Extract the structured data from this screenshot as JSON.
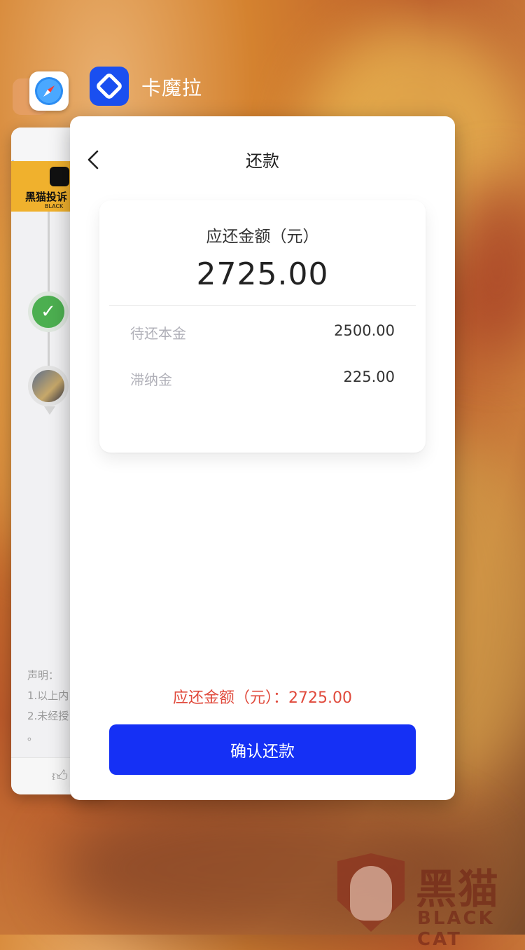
{
  "switcher": {
    "app_name": "卡魔拉",
    "app_icon": "kamola-logo-icon",
    "bg_app_icon": "safari-icon"
  },
  "background_app": {
    "banner_text": "黑猫投诉",
    "banner_sub": "BLACK",
    "statement_lines": [
      "声明：",
      "1.以上内",
      "2.未经授",
      "。"
    ]
  },
  "nav": {
    "title": "还款"
  },
  "repayment": {
    "due_label": "应还金额（元）",
    "due_amount": "2725.00",
    "rows": [
      {
        "label": "待还本金",
        "value": "2500.00"
      },
      {
        "label": "滞纳金",
        "value": "225.00"
      }
    ],
    "summary": "应还金额（元）：2725.00",
    "confirm_label": "确认还款"
  },
  "watermark": {
    "cn": "黑猫",
    "en": "BLACK CAT"
  },
  "colors": {
    "primary": "#1530f5",
    "summary_red": "#e04a3c"
  }
}
